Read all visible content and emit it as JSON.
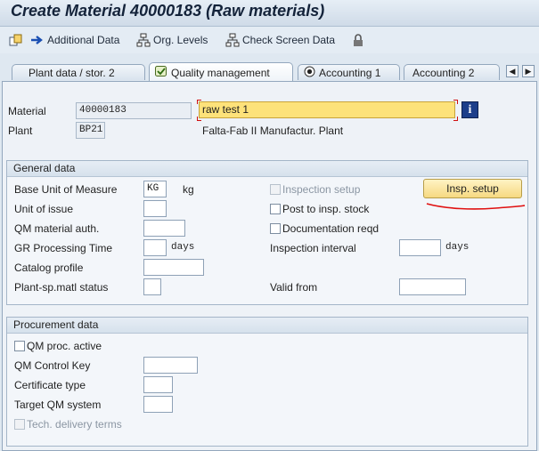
{
  "window": {
    "title": "Create Material 40000183 (Raw materials)"
  },
  "toolbar": {
    "items": [
      {
        "label": ""
      },
      {
        "label": "Additional Data"
      },
      {
        "label": "Org. Levels"
      },
      {
        "label": "Check Screen Data"
      },
      {
        "label": ""
      }
    ]
  },
  "tabs": [
    {
      "label": "Plant data / stor. 2"
    },
    {
      "label": "Quality management"
    },
    {
      "label": "Accounting 1"
    },
    {
      "label": "Accounting 2"
    }
  ],
  "header": {
    "material_label": "Material",
    "material_value": "40000183",
    "material_desc": "raw test 1",
    "plant_label": "Plant",
    "plant_value": "BP21",
    "plant_desc": "Falta-Fab II Manufactur. Plant"
  },
  "general": {
    "title": "General data",
    "base_uom_label": "Base Unit of Measure",
    "base_uom_value": "KG",
    "base_uom_text": "kg",
    "unit_issue_label": "Unit of issue",
    "qm_auth_label": "QM material auth.",
    "gr_time_label": "GR Processing Time",
    "days1": "days",
    "catalog_label": "Catalog profile",
    "plant_status_label": "Plant-sp.matl status",
    "insp_setup_label": "Inspection setup",
    "insp_setup_button": "Insp. setup",
    "post_insp_label": "Post to insp. stock",
    "doc_reqd_label": "Documentation reqd",
    "insp_interval_label": "Inspection interval",
    "days2": "days",
    "valid_from_label": "Valid from"
  },
  "procurement": {
    "title": "Procurement data",
    "qm_active_label": "QM proc. active",
    "control_key_label": "QM Control Key",
    "cert_type_label": "Certificate type",
    "target_qm_label": "Target QM system",
    "tech_delivery_label": "Tech. delivery terms"
  },
  "colors": {
    "highlight": "#fde27a",
    "annotation": "#e01010",
    "tab_active": "#ffffff"
  }
}
